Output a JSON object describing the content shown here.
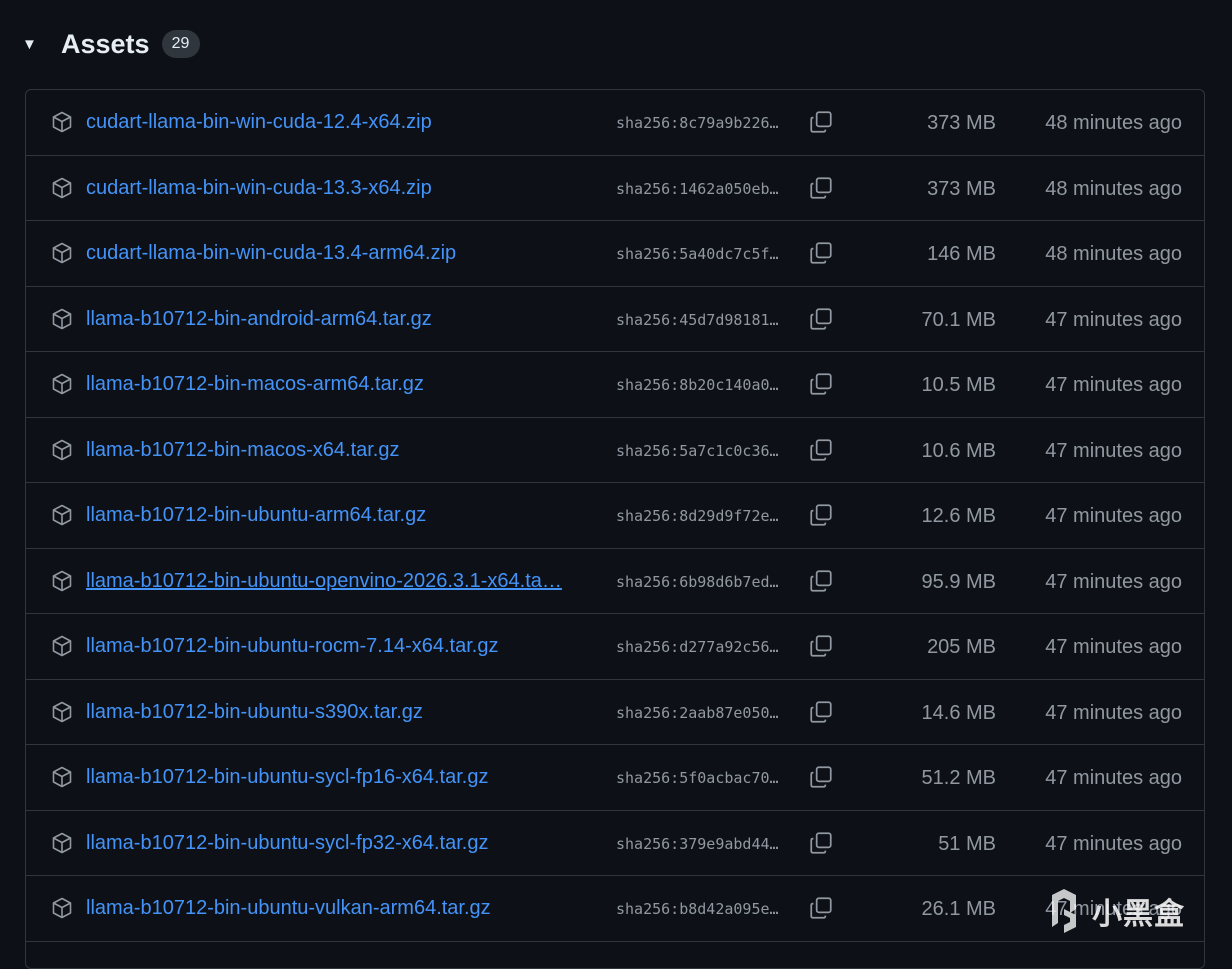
{
  "header": {
    "caret": "▼",
    "title": "Assets",
    "count": "29"
  },
  "assets": [
    {
      "name": "cudart-llama-bin-win-cuda-12.4-x64.zip",
      "sha": "sha256:8c79a9b226…",
      "size": "373 MB",
      "time": "48 minutes ago"
    },
    {
      "name": "cudart-llama-bin-win-cuda-13.3-x64.zip",
      "sha": "sha256:1462a050eb…",
      "size": "373 MB",
      "time": "48 minutes ago"
    },
    {
      "name": "cudart-llama-bin-win-cuda-13.4-arm64.zip",
      "sha": "sha256:5a40dc7c5f…",
      "size": "146 MB",
      "time": "48 minutes ago"
    },
    {
      "name": "llama-b10712-bin-android-arm64.tar.gz",
      "sha": "sha256:45d7d98181…",
      "size": "70.1 MB",
      "time": "47 minutes ago"
    },
    {
      "name": "llama-b10712-bin-macos-arm64.tar.gz",
      "sha": "sha256:8b20c140a0…",
      "size": "10.5 MB",
      "time": "47 minutes ago"
    },
    {
      "name": "llama-b10712-bin-macos-x64.tar.gz",
      "sha": "sha256:5a7c1c0c36…",
      "size": "10.6 MB",
      "time": "47 minutes ago"
    },
    {
      "name": "llama-b10712-bin-ubuntu-arm64.tar.gz",
      "sha": "sha256:8d29d9f72e…",
      "size": "12.6 MB",
      "time": "47 minutes ago"
    },
    {
      "name": "llama-b10712-bin-ubuntu-openvino-2026.3.1-x64.ta…",
      "sha": "sha256:6b98d6b7ed…",
      "size": "95.9 MB",
      "time": "47 minutes ago",
      "hover": true
    },
    {
      "name": "llama-b10712-bin-ubuntu-rocm-7.14-x64.tar.gz",
      "sha": "sha256:d277a92c56…",
      "size": "205 MB",
      "time": "47 minutes ago"
    },
    {
      "name": "llama-b10712-bin-ubuntu-s390x.tar.gz",
      "sha": "sha256:2aab87e050…",
      "size": "14.6 MB",
      "time": "47 minutes ago"
    },
    {
      "name": "llama-b10712-bin-ubuntu-sycl-fp16-x64.tar.gz",
      "sha": "sha256:5f0acbac70…",
      "size": "51.2 MB",
      "time": "47 minutes ago"
    },
    {
      "name": "llama-b10712-bin-ubuntu-sycl-fp32-x64.tar.gz",
      "sha": "sha256:379e9abd44…",
      "size": "51 MB",
      "time": "47 minutes ago"
    },
    {
      "name": "llama-b10712-bin-ubuntu-vulkan-arm64.tar.gz",
      "sha": "sha256:b8d42a095e…",
      "size": "26.1 MB",
      "time": "47 minutes ago"
    }
  ],
  "watermark": {
    "text": "小黑盒"
  },
  "colors": {
    "background": "#0d1117",
    "border": "#30363d",
    "link": "#4493f8",
    "muted": "#9198a1"
  },
  "icons": {
    "asset": "package-icon",
    "copy": "copy-icon",
    "toggle": "triangle-down-icon"
  }
}
